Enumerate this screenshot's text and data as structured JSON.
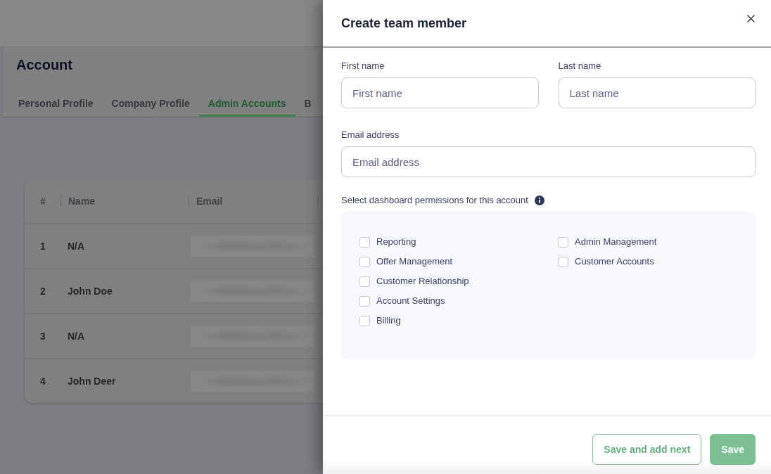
{
  "page": {
    "title": "Account",
    "tabs": [
      {
        "label": "Personal Profile",
        "selected": false
      },
      {
        "label": "Company Profile",
        "selected": false
      },
      {
        "label": "Admin Accounts",
        "selected": true
      },
      {
        "label": "B",
        "selected": false
      }
    ]
  },
  "table": {
    "columns": [
      "#",
      "Name",
      "Email"
    ],
    "rows": [
      {
        "number": "1",
        "name": "N/A"
      },
      {
        "number": "2",
        "name": "John Doe"
      },
      {
        "number": "3",
        "name": "N/A"
      },
      {
        "number": "4",
        "name": "John Deer"
      }
    ]
  },
  "drawer": {
    "title": "Create team member",
    "name_fields": [
      {
        "label": "First name",
        "placeholder": "First name"
      },
      {
        "label": "Last name",
        "placeholder": "Last name"
      }
    ],
    "email_field": {
      "label": "Email address",
      "placeholder": "Email address"
    },
    "permissions": {
      "label": "Select dashboard permissions for this account",
      "options": [
        {
          "label": "Reporting",
          "checked": false
        },
        {
          "label": "Offer Management",
          "checked": false
        },
        {
          "label": "Customer Relationship",
          "checked": false
        },
        {
          "label": "Account Settings",
          "checked": false
        },
        {
          "label": "Billing",
          "checked": false
        },
        {
          "label": "Admin Management",
          "checked": false
        },
        {
          "label": "Customer Accounts",
          "checked": false
        }
      ]
    },
    "buttons": [
      {
        "label": "Save and add next",
        "kind": "secondary"
      },
      {
        "label": "Save",
        "kind": "primary"
      }
    ]
  }
}
